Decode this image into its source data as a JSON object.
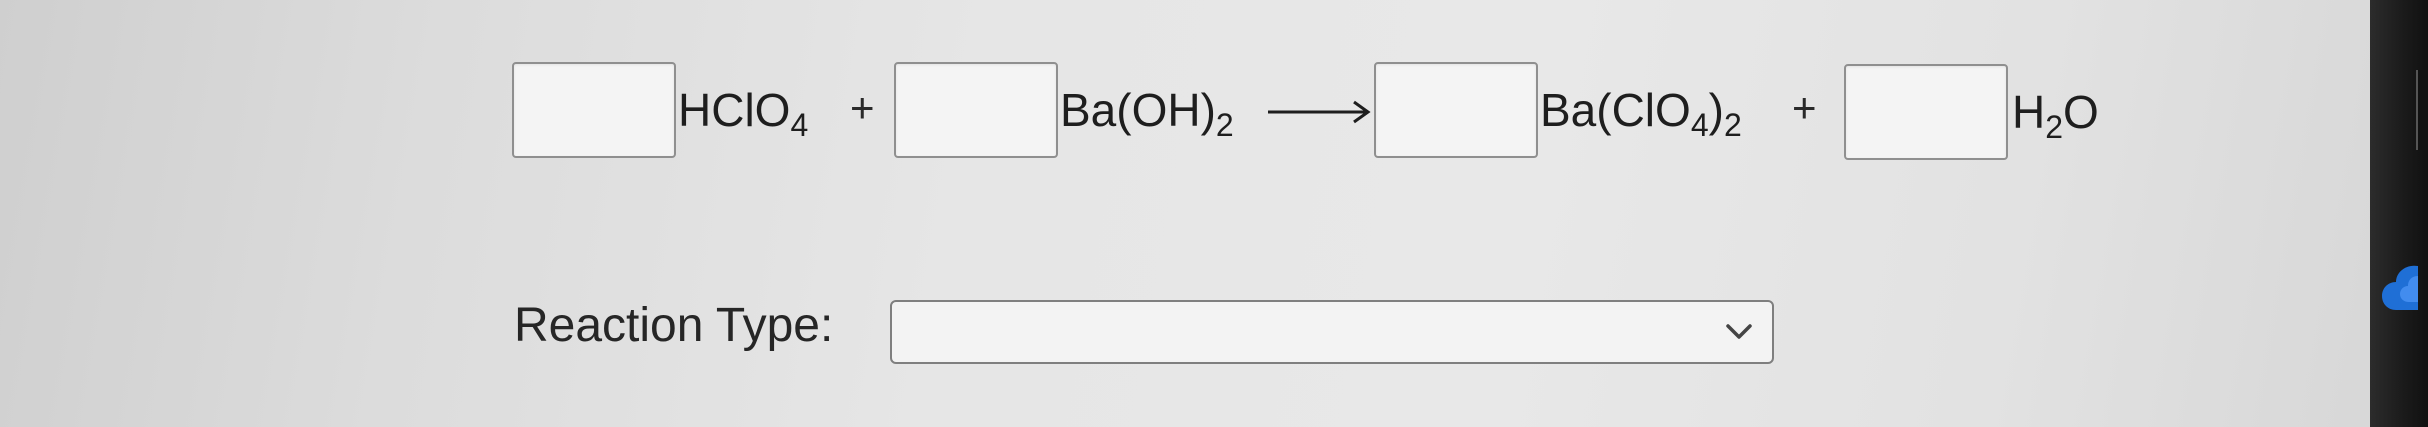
{
  "equation": {
    "reactant_1": {
      "main": "HClO",
      "sub": "4"
    },
    "plus_1": "+",
    "reactant_2": {
      "main": "Ba(OH)",
      "sub": "2"
    },
    "product_1": {
      "pre": "Ba(ClO",
      "sub1": "4",
      "mid": ")",
      "sub2": "2"
    },
    "plus_2": "+",
    "product_2": {
      "pre": "H",
      "sub": "2",
      "post": "O"
    },
    "coefficients": [
      "",
      "",
      "",
      ""
    ]
  },
  "reaction_type": {
    "label": "Reaction Type:",
    "selected": ""
  },
  "icons": {
    "arrow": "reaction-arrow-icon",
    "dropdown": "chevron-down-icon",
    "cloud": "cloud-icon"
  },
  "colors": {
    "cloud": "#1f6fd6"
  }
}
